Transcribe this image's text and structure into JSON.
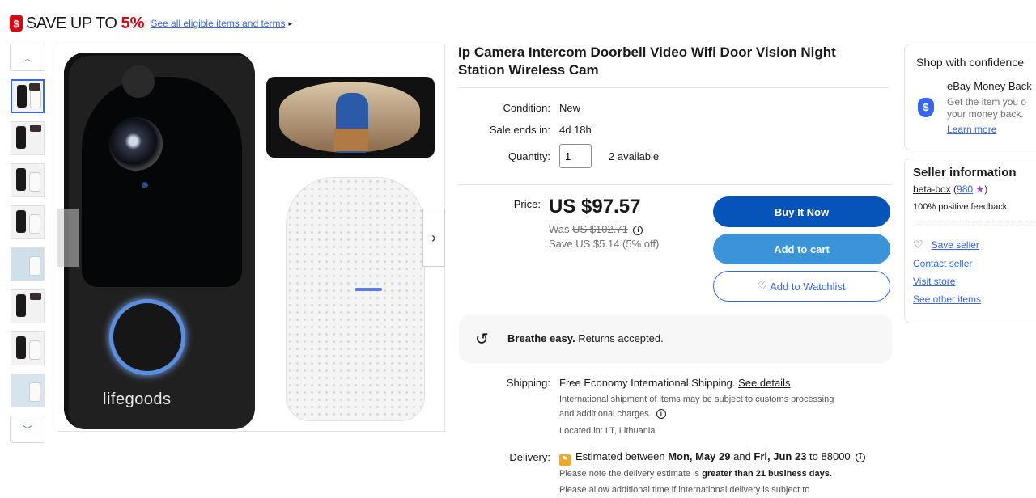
{
  "promo": {
    "icon_glyph": "$",
    "text": "SAVE UP TO",
    "percent": "5%",
    "link": "See all eligible items and terms",
    "arrow": "▸"
  },
  "gallery": {
    "prev_glyph": "︿",
    "next_glyph": "﹀",
    "thumbnail_count": 8,
    "active_index": 0,
    "main_image": {
      "brand_text": "lifegoods",
      "next_glyph": "›"
    }
  },
  "product": {
    "title": "Ip Camera Intercom Doorbell Video Wifi Door Vision Night Station Wireless Cam",
    "condition_label": "Condition:",
    "condition_value": "New",
    "sale_ends_label": "Sale ends in:",
    "sale_ends_value": "4d 18h",
    "quantity_label": "Quantity:",
    "quantity_value": "1",
    "available": "2 available"
  },
  "pricing": {
    "price_label": "Price:",
    "price": "US $97.57",
    "was_label": "Was",
    "was_price": "US $102.71",
    "info_glyph": "i",
    "save_text": "Save US $5.14 (5% off)"
  },
  "actions": {
    "buy_now": "Buy It Now",
    "add_to_cart": "Add to cart",
    "watchlist_icon": "♡",
    "watchlist": "Add to Watchlist"
  },
  "returns": {
    "icon_glyph": "↺",
    "bold": "Breathe easy.",
    "text": " Returns accepted."
  },
  "shipping": {
    "label": "Shipping:",
    "free": "Free",
    "text": " Economy International Shipping. ",
    "link": "See details",
    "note1": "International shipment of items may be subject to customs processing",
    "note2": "and additional charges.",
    "info_glyph": "i",
    "location": "Located in: LT, Lithuania"
  },
  "delivery": {
    "label": "Delivery:",
    "flag_glyph": "⚑",
    "estimated": "Estimated between ",
    "date_from": "Mon, May 29",
    "and": " and ",
    "date_to": "Fri, Jun 23",
    "to_zip": " to 88000",
    "info_glyph": "i",
    "note_prefix": "Please note the delivery estimate is ",
    "note_bold": "greater than 21 business days.",
    "note2": "Please allow additional time if international delivery is subject to"
  },
  "confidence": {
    "title": "Shop with confidence",
    "shield_glyph": "$",
    "heading": "eBay Money Back",
    "desc1": "Get the item you o",
    "desc2": "your money back.",
    "link": "Learn more"
  },
  "seller": {
    "title": "Seller information",
    "name": "beta-box",
    "open_paren": " (",
    "score": "980",
    "star": "★",
    "close_paren": ")",
    "feedback": "100% positive feedback",
    "heart_glyph": "♡",
    "save_seller": "Save seller",
    "contact": "Contact seller",
    "visit": "Visit store",
    "other": "See other items"
  },
  "colors": {
    "accent_blue": "#3665f3",
    "buy_now_bg": "#0654ba",
    "cart_bg": "#3b93d8",
    "promo_red": "#e0000f"
  }
}
